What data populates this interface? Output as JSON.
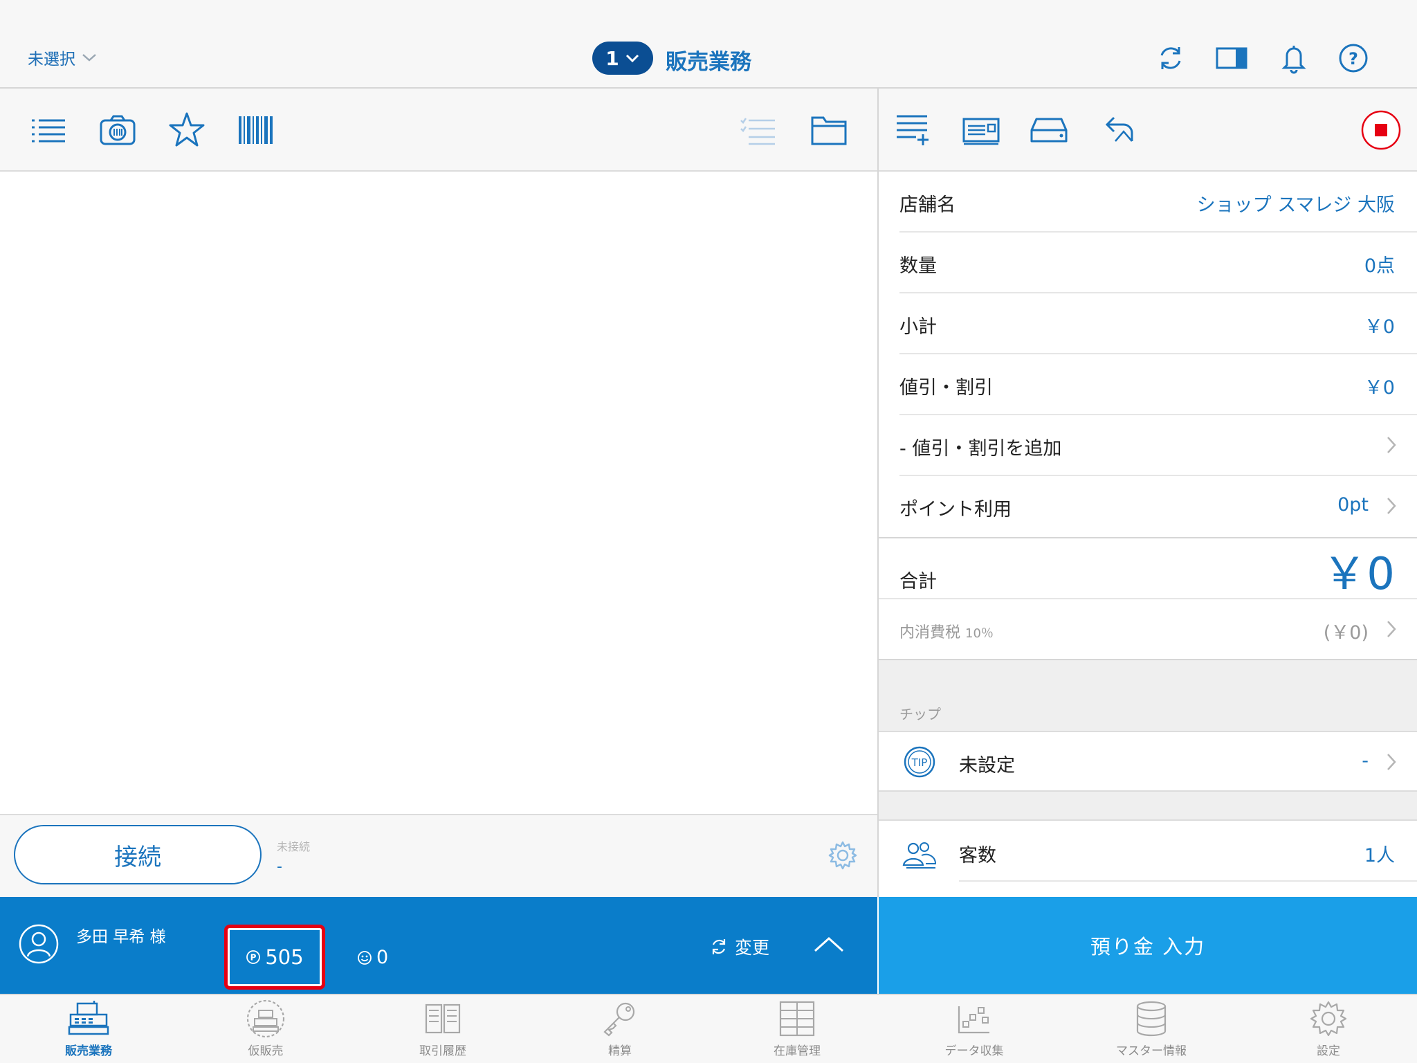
{
  "header": {
    "store_selector": "未選択",
    "register_number": "1",
    "title": "販売業務",
    "icons": [
      "refresh-icon",
      "split-view-icon",
      "bell-icon",
      "help-icon"
    ]
  },
  "left_toolbar": {
    "icons": [
      "list-icon",
      "camera-icon",
      "star-icon",
      "barcode-icon",
      "checklist-icon",
      "folder-icon"
    ]
  },
  "connection": {
    "button_label": "接続",
    "status_label": "未接続",
    "status_value": "-"
  },
  "customer": {
    "name": "多田 早希 様",
    "points": "505",
    "stamps": "0",
    "change_label": "変更"
  },
  "right_toolbar": {
    "icons": [
      "list-add-icon",
      "receipt-icon",
      "drawer-icon",
      "return-icon",
      "stop-icon"
    ]
  },
  "summary": {
    "store_label": "店舗名",
    "store_value": "ショップ スマレジ 大阪",
    "quantity_label": "数量",
    "quantity_value": "0点",
    "subtotal_label": "小計",
    "subtotal_value": "￥0",
    "discount_label": "値引・割引",
    "discount_value": "￥0",
    "add_discount_label": "- 値引・割引を追加",
    "points_use_label": "ポイント利用",
    "points_use_value": "0pt",
    "total_label": "合計",
    "total_value": "￥0",
    "tax_label": "内消費税",
    "tax_rate": "10％",
    "tax_value": "(￥0)"
  },
  "tip": {
    "section_label": "チップ",
    "icon_text": "TIP",
    "label": "未設定",
    "value": "-"
  },
  "guests": {
    "label": "客数",
    "value": "1人"
  },
  "deposit_button": "預り金 入力",
  "tabs": [
    {
      "label": "販売業務",
      "icon": "register-icon",
      "active": true
    },
    {
      "label": "仮販売",
      "icon": "temp-sale-icon",
      "active": false
    },
    {
      "label": "取引履歴",
      "icon": "history-icon",
      "active": false
    },
    {
      "label": "精算",
      "icon": "key-icon",
      "active": false
    },
    {
      "label": "在庫管理",
      "icon": "inventory-icon",
      "active": false
    },
    {
      "label": "データ収集",
      "icon": "data-icon",
      "active": false
    },
    {
      "label": "マスター情報",
      "icon": "database-icon",
      "active": false
    },
    {
      "label": "設定",
      "icon": "gear-icon",
      "active": false
    }
  ],
  "colors": {
    "accent": "#1b74bd",
    "header_pill": "#0b4e93",
    "customer_bar": "#0a7dca",
    "deposit": "#1a9fe8",
    "highlight": "#e60012"
  }
}
